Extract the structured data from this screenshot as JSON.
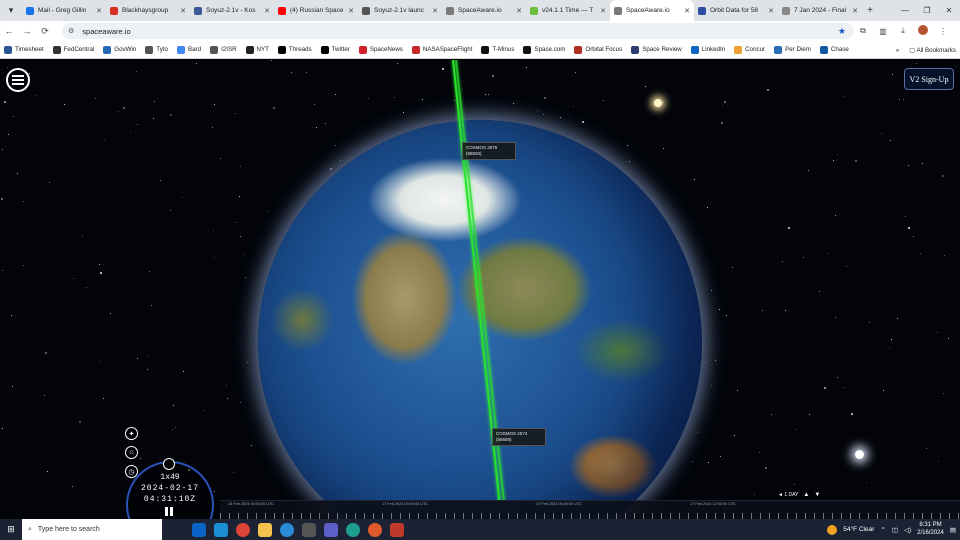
{
  "tabs": [
    {
      "title": "Mail - Greg Gillin",
      "color": "#1a73e8",
      "active": false
    },
    {
      "title": "Blackhaysgroup",
      "color": "#d93025",
      "active": false
    },
    {
      "title": "Soyuz-2.1v - Kos",
      "color": "#3b5998",
      "active": false
    },
    {
      "title": "(4) Russian Space",
      "color": "#ff0000",
      "active": false
    },
    {
      "title": "Soyuz-2.1v launc",
      "color": "#555555",
      "active": false
    },
    {
      "title": "SpaceAware.io",
      "color": "#7a7a7a",
      "active": false
    },
    {
      "title": "v24.1.1 Time — T",
      "color": "#6bbf3a",
      "active": false
    },
    {
      "title": "SpaceAware.io",
      "color": "#7a7a7a",
      "active": true
    },
    {
      "title": "Orbit Data for 58",
      "color": "#2b4fa0",
      "active": false
    },
    {
      "title": "7 Jan 2024 - Final",
      "color": "#888888",
      "active": false
    }
  ],
  "address": {
    "url": "spaceaware.io"
  },
  "bookmarks": [
    {
      "label": "Timesheet",
      "color": "#2b5797"
    },
    {
      "label": "FedCentral",
      "color": "#333333"
    },
    {
      "label": "GovWin",
      "color": "#2a6bb5"
    },
    {
      "label": "Tyto",
      "color": "#555555"
    },
    {
      "label": "Bard",
      "color": "#4285f4"
    },
    {
      "label": "I2ISR",
      "color": "#555555"
    },
    {
      "label": "NYT",
      "color": "#222222"
    },
    {
      "label": "Threads",
      "color": "#000000"
    },
    {
      "label": "Twitter",
      "color": "#000000"
    },
    {
      "label": "SpaceNews",
      "color": "#d12027"
    },
    {
      "label": "NASASpaceFlight",
      "color": "#c62828"
    },
    {
      "label": "T-Minus",
      "color": "#111111"
    },
    {
      "label": "Space.com",
      "color": "#111111"
    },
    {
      "label": "Orbital Focus",
      "color": "#b03020"
    },
    {
      "label": "Space Review",
      "color": "#2c3e73"
    },
    {
      "label": "LinkedIn",
      "color": "#0a66c2"
    },
    {
      "label": "Concur",
      "color": "#f0a030"
    },
    {
      "label": "Per Diem",
      "color": "#2a6bb5"
    },
    {
      "label": "Chase",
      "color": "#1258a8"
    }
  ],
  "bookmarks_more": "»",
  "all_bookmarks": "All Bookmarks",
  "app": {
    "signup_label": "V2 Sign-Up",
    "satellites": [
      {
        "name": "COSMOS 2575",
        "id": "(58820)"
      },
      {
        "name": "COSMOS 2574",
        "id": "(58658)"
      }
    ],
    "clock": {
      "speed": "1x49",
      "date": "2024-02-17",
      "time": "04:31:10Z"
    },
    "timeline_labels": [
      "16 Feb 2024 16:00:00 UTC",
      "17 Feb 2024 00:00:00 UTC",
      "17 Feb 2024 06:00:00 UTC",
      "17 Feb 2024 12:00:00 UTC"
    ],
    "zoom_label": "◄ 1 DAY"
  },
  "taskbar": {
    "search_placeholder": "Type here to search",
    "weather": "54°F  Clear",
    "time": "8:31 PM",
    "date": "2/16/2024"
  }
}
